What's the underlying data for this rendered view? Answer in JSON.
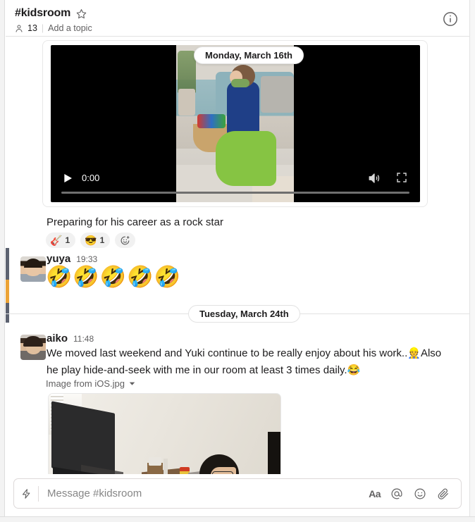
{
  "header": {
    "channel_name": "#kidsroom",
    "star_icon": "star-icon",
    "member_icon": "member-icon",
    "member_count": "13",
    "divider": "|",
    "topic_placeholder": "Add a topic",
    "info_icon": "info-icon"
  },
  "messages": {
    "video_message": {
      "date_divider": "Monday, March 16th",
      "video": {
        "play_icon": "play-icon",
        "current_time": "0:00",
        "volume_icon": "volume-icon",
        "fullscreen_icon": "fullscreen-icon",
        "progress_percent": "0"
      },
      "caption": "Preparing for his career as a rock star",
      "reactions": [
        {
          "emoji": "🎸",
          "name": "guitar-reaction",
          "count": "1"
        },
        {
          "emoji": "😎",
          "name": "sunglasses-reaction",
          "count": "1"
        }
      ],
      "add_reaction_icon": "add-reaction-icon"
    },
    "yuya_message": {
      "author": "yuya",
      "time": "19:33",
      "avatar": "avatar-yuya",
      "emoji": "🤣",
      "emoji_name": "rolling-on-the-floor-laughing",
      "emoji_repeat": 5
    },
    "date_divider": "Tuesday, March 24th",
    "aiko_message": {
      "author": "aiko",
      "time": "11:48",
      "avatar": "avatar-aiko",
      "text_part_1": "We moved last weekend and Yuki continue to be really enjoy about his work..",
      "inline_emoji_1": "👷",
      "text_part_2": "Also he play hide-and-seek with me in our room at least 3 times daily.",
      "inline_emoji_2": "😂",
      "file_name": "Image from iOS.jpg",
      "file_chevron_icon": "chevron-down-icon",
      "image_alt": "image-attachment"
    }
  },
  "composer": {
    "lightning_icon": "lightning-bolt-icon",
    "placeholder": "Message #kidsroom",
    "value": "",
    "actions": [
      {
        "name": "format-text-button",
        "label": "Aa"
      },
      {
        "name": "mention-button",
        "label": "@"
      },
      {
        "name": "emoji-button",
        "label": "☺"
      },
      {
        "name": "attach-file-button",
        "label": "📎"
      }
    ]
  },
  "colors": {
    "accent_orange": "#eca336",
    "text_primary": "#1d1c1d",
    "text_secondary": "#616061",
    "border": "#e2e2e2"
  }
}
